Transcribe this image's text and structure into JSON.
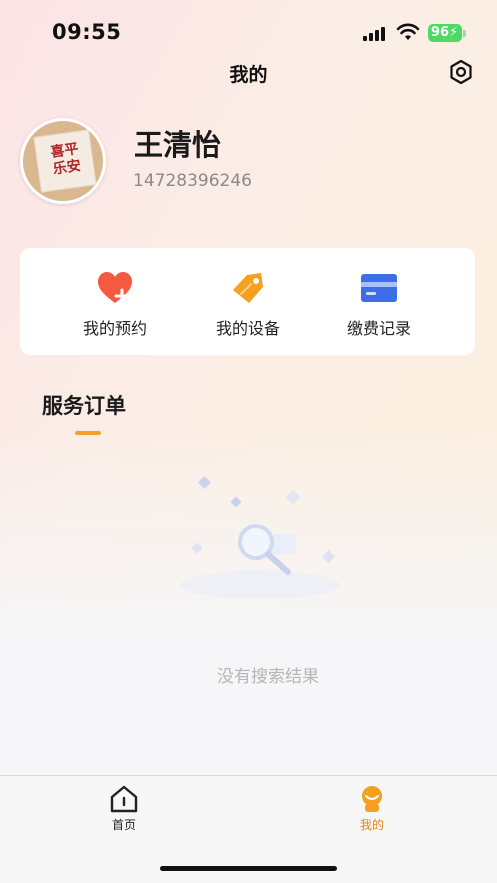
{
  "status_bar": {
    "time": "09:55",
    "battery": "96"
  },
  "header": {
    "title": "我的"
  },
  "profile": {
    "name": "王清怡",
    "phone": "14728396246"
  },
  "quick_actions": [
    {
      "label": "我的预约",
      "icon": "heart-plus-icon"
    },
    {
      "label": "我的设备",
      "icon": "tag-icon"
    },
    {
      "label": "缴费记录",
      "icon": "card-icon"
    }
  ],
  "section": {
    "title": "服务订单"
  },
  "empty_state": {
    "text": "没有搜索结果"
  },
  "tabbar": {
    "items": [
      {
        "label": "首页",
        "icon": "home-icon"
      },
      {
        "label": "我的",
        "icon": "profile-icon"
      }
    ]
  },
  "colors": {
    "accent": "#f0a325",
    "active_tab": "#e8840c",
    "inactive_tab": "#222222"
  }
}
